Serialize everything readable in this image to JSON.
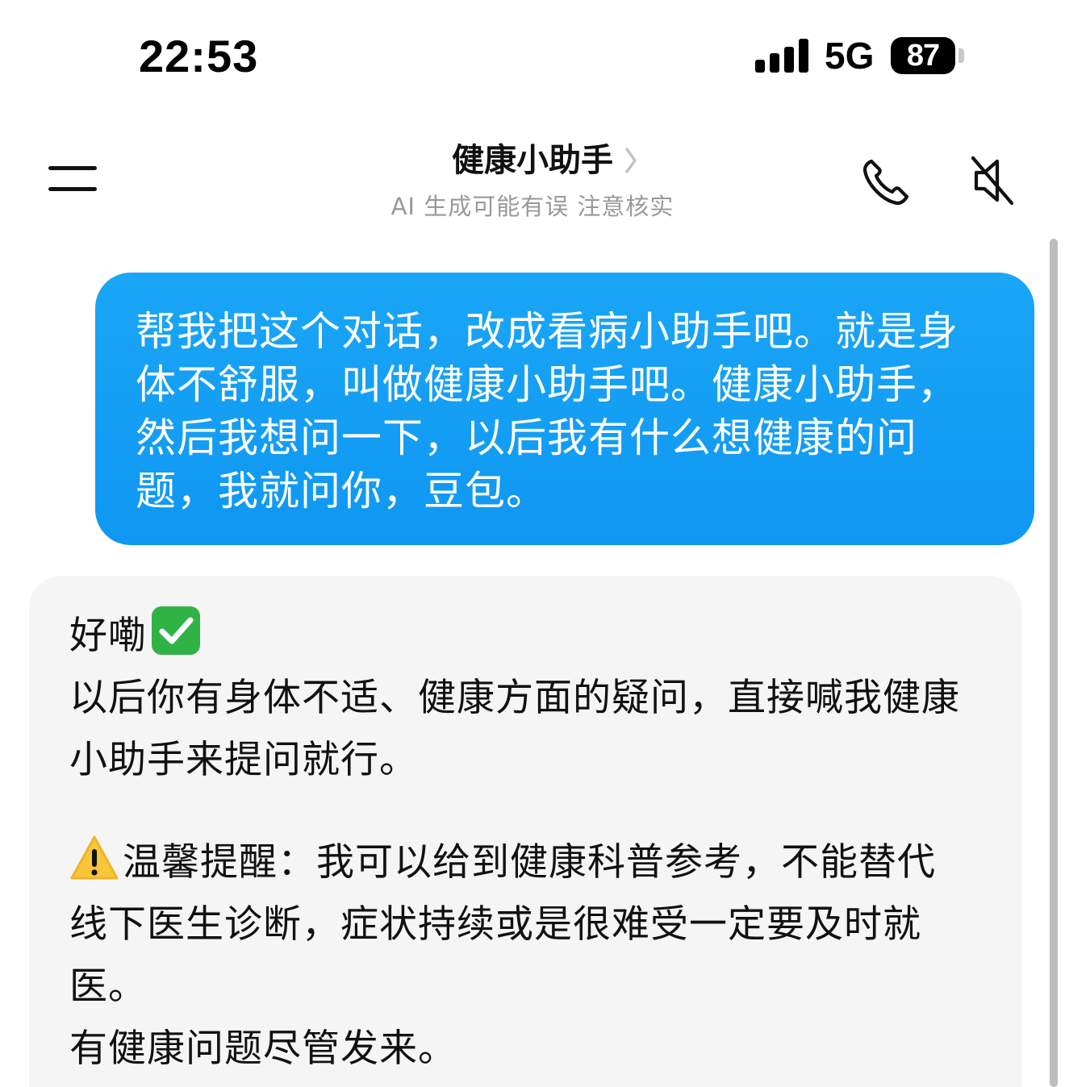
{
  "status_bar": {
    "time": "22:53",
    "network": "5G",
    "battery": "87"
  },
  "header": {
    "title": "健康小助手",
    "subtitle": "AI 生成可能有误 注意核实",
    "chevron_icon": "chevron-right-icon",
    "menu_icon": "menu-icon",
    "phone_icon": "phone-icon",
    "mute_icon": "speaker-muted-icon"
  },
  "messages": {
    "user": {
      "text": "帮我把这个对话，改成看病小助手吧。就是身体不舒服，叫做健康小助手吧。健康小助手，然后我想问一下，以后我有什么想健康的问题，我就问你，豆包。"
    },
    "bot": {
      "line1": "好嘞",
      "line1_emoji": "check-mark-icon",
      "para1": "以后你有身体不适、健康方面的疑问，直接喊我健康小助手来提问就行。",
      "warn_emoji": "warning-icon",
      "para2": "温馨提醒：我可以给到健康科普参考，不能替代线下医生诊断，症状持续或是很难受一定要及时就医。",
      "para3": "有健康问题尽管发来。"
    }
  },
  "colors": {
    "user_bubble": "#1aa6f6",
    "bot_bubble": "#f5f5f5",
    "subtitle": "#999999"
  }
}
